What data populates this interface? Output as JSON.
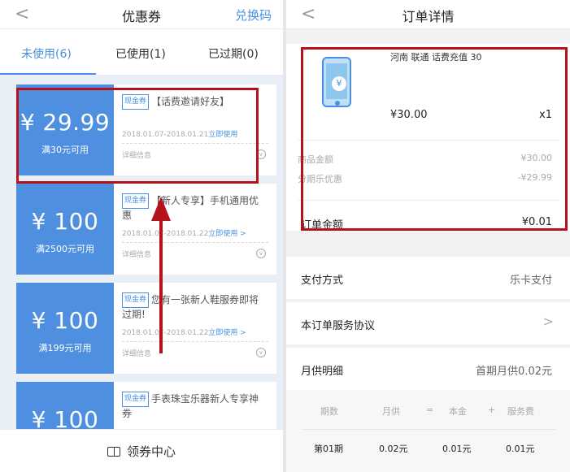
{
  "left": {
    "nav": {
      "back": "<",
      "title": "优惠券",
      "action": "兑换码"
    },
    "tabs": [
      {
        "label": "未使用(6)"
      },
      {
        "label": "已使用(1)"
      },
      {
        "label": "已过期(0)"
      }
    ],
    "coupons": [
      {
        "amount": "¥ 29.99",
        "condition": "满30元可用",
        "tag": "现金券",
        "title": "【话费邀请好友】",
        "date": "2018.01.07-2018.01.21",
        "use_label": "立即使用",
        "detail": "详细信息"
      },
      {
        "amount": "¥ 100",
        "condition": "满2500元可用",
        "tag": "现金券",
        "title": "【新人专享】手机通用优惠",
        "date": "2018.01.07-2018.01.22",
        "use_label": "立即使用 >",
        "detail": "详细信息"
      },
      {
        "amount": "¥ 100",
        "condition": "满199元可用",
        "tag": "现金券",
        "title": "您有一张新人鞋服券即将过期!",
        "date": "2018.01.07-2018.01.22",
        "use_label": "立即使用 >",
        "detail": "详细信息"
      },
      {
        "amount": "¥ 100",
        "condition": "",
        "tag": "现金券",
        "title": "手表珠宝乐器新人专享神券",
        "date": "",
        "use_label": "",
        "detail": ""
      }
    ],
    "bottom": {
      "label": "领券中心"
    }
  },
  "right": {
    "nav": {
      "back": "<",
      "title": "订单详情"
    },
    "product": {
      "name": "河南 联通 话费充值 30",
      "price": "¥30.00",
      "qty": "x1",
      "goods_amount_label": "商品金额",
      "goods_amount": "¥30.00",
      "discount_label": "分期乐优惠",
      "discount": "-¥29.99",
      "total_label": "订单金额",
      "total": "¥0.01"
    },
    "payment": {
      "label": "支付方式",
      "value": "乐卡支付"
    },
    "agreement": {
      "label": "本订单服务协议",
      "chevron": ">"
    },
    "monthly": {
      "label": "月供明细",
      "value": "首期月供0.02元"
    },
    "table": {
      "headers": [
        "期数",
        "月供",
        "=",
        "本金",
        "+",
        "服务费"
      ],
      "row": [
        "第01期",
        "0.02元",
        "0.01元",
        "0.01元"
      ]
    }
  },
  "colors": {
    "accent": "#4a90e2",
    "annotation": "#b5121b",
    "coupon_stub": "#4e8fe0"
  }
}
